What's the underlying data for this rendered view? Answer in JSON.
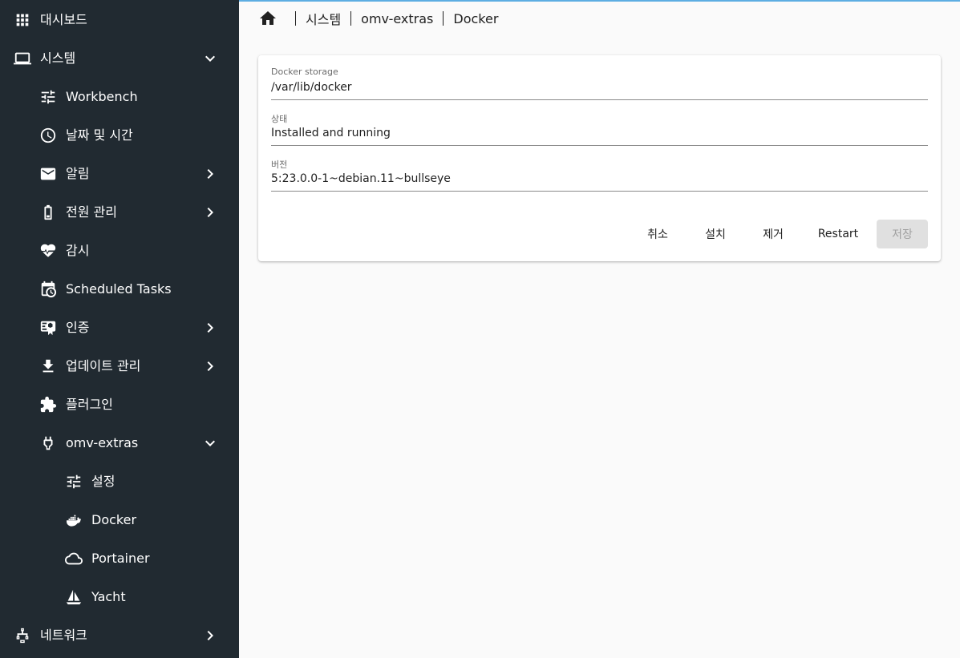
{
  "colors": {
    "sidebar_bg": "#212a31",
    "accent": "#5dade2",
    "content_bg": "#fafafa"
  },
  "sidebar": {
    "items": [
      {
        "label": "대시보드",
        "icon": "apps-grid-icon",
        "chevron": ""
      },
      {
        "label": "시스템",
        "icon": "laptop-icon",
        "chevron": "expanded"
      },
      {
        "label": "Workbench",
        "icon": "tune-sliders-icon",
        "chevron": ""
      },
      {
        "label": "날짜 및 시간",
        "icon": "clock-icon",
        "chevron": ""
      },
      {
        "label": "알림",
        "icon": "mail-icon",
        "chevron": "collapsed"
      },
      {
        "label": "전원 관리",
        "icon": "battery-icon",
        "chevron": "collapsed"
      },
      {
        "label": "감시",
        "icon": "heart-pulse-icon",
        "chevron": ""
      },
      {
        "label": "Scheduled Tasks",
        "icon": "calendar-clock-icon",
        "chevron": ""
      },
      {
        "label": "인증",
        "icon": "certificate-icon",
        "chevron": "collapsed"
      },
      {
        "label": "업데이트 관리",
        "icon": "download-icon",
        "chevron": "collapsed"
      },
      {
        "label": "플러그인",
        "icon": "puzzle-icon",
        "chevron": ""
      },
      {
        "label": "omv-extras",
        "icon": "power-plug-icon",
        "chevron": "expanded"
      },
      {
        "label": "설정",
        "icon": "tune-sliders-icon",
        "chevron": ""
      },
      {
        "label": "Docker",
        "icon": "docker-whale-icon",
        "chevron": ""
      },
      {
        "label": "Portainer",
        "icon": "cloud-icon",
        "chevron": ""
      },
      {
        "label": "Yacht",
        "icon": "sailboat-icon",
        "chevron": ""
      },
      {
        "label": "네트워크",
        "icon": "network-lan-icon",
        "chevron": "collapsed"
      }
    ]
  },
  "breadcrumb": {
    "home_icon": "home-icon",
    "items": [
      "시스템",
      "omv-extras",
      "Docker"
    ]
  },
  "form": {
    "fields": [
      {
        "label": "Docker storage",
        "value": "/var/lib/docker"
      },
      {
        "label": "상태",
        "value": "Installed and running"
      },
      {
        "label": "버전",
        "value": "5:23.0.0-1~debian.11~bullseye"
      }
    ],
    "buttons": {
      "cancel": "취소",
      "install": "설치",
      "remove": "제거",
      "restart": "Restart",
      "save": "저장"
    }
  }
}
